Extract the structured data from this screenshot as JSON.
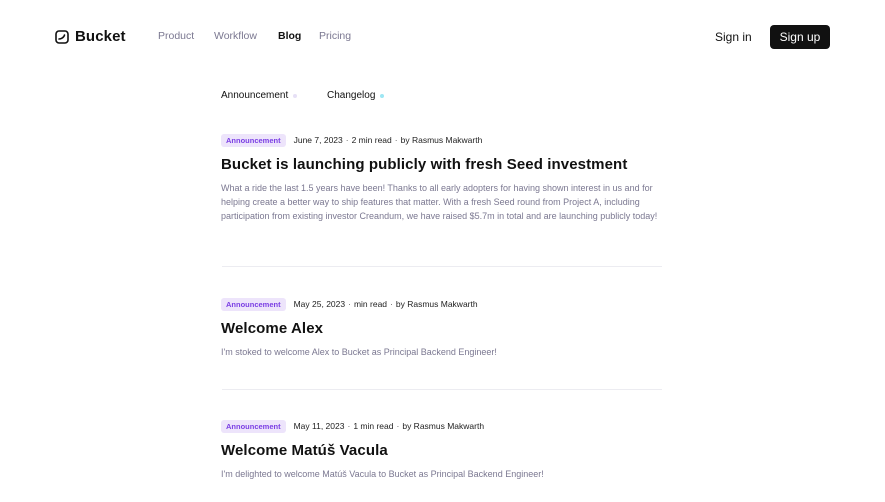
{
  "brand": {
    "name": "Bucket"
  },
  "nav": {
    "links": [
      {
        "label": "Product",
        "active": false
      },
      {
        "label": "Workflow",
        "active": false
      },
      {
        "label": "Blog",
        "active": true
      },
      {
        "label": "Pricing",
        "active": false
      }
    ],
    "signin_label": "Sign in",
    "signup_label": "Sign up"
  },
  "filters": [
    {
      "label": "Announcement",
      "dot_color": "#e6e0f6"
    },
    {
      "label": "Changelog",
      "dot_color": "#9ee7f4"
    }
  ],
  "posts": [
    {
      "tag": "Announcement",
      "date": "June 7, 2023",
      "read_time": "2 min read",
      "author": "by Rasmus Makwarth",
      "title": "Bucket is launching publicly with fresh Seed investment",
      "excerpt": "What a ride the last 1.5 years have been! Thanks to all early adopters for having shown interest in us and for helping create a better way to ship features that matter. With a fresh Seed round from Project A, including participation from existing investor Creandum, we have raised $5.7m in total and are launching publicly today!"
    },
    {
      "tag": "Announcement",
      "date": "May 25, 2023",
      "read_time": "min read",
      "author": "by Rasmus Makwarth",
      "title": "Welcome Alex",
      "excerpt": "I'm stoked to welcome Alex to Bucket as Principal Backend Engineer!"
    },
    {
      "tag": "Announcement",
      "date": "May 11, 2023",
      "read_time": "1 min read",
      "author": "by Rasmus Makwarth",
      "title": "Welcome Matúš Vacula",
      "excerpt": "I'm delighted to welcome Matúš Vacula to Bucket as Principal Backend Engineer!"
    }
  ],
  "colors": {
    "badge_bg": "#ede4fb",
    "badge_text": "#7b3fe4",
    "muted_text": "#7b7891"
  }
}
